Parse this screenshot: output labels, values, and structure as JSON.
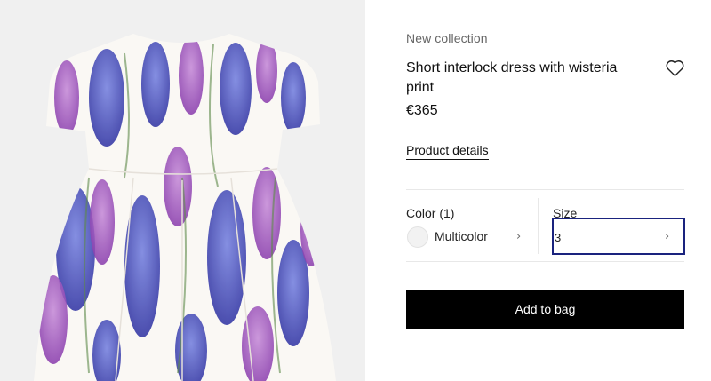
{
  "product": {
    "collection_label": "New collection",
    "title": "Short interlock dress with wisteria print",
    "price": "€365",
    "details_link": "Product details"
  },
  "color": {
    "label": "Color (1)",
    "value": "Multicolor",
    "swatch_color": "#f2f2f2"
  },
  "size": {
    "label": "Size",
    "value": "3"
  },
  "cart": {
    "add_label": "Add to bag"
  },
  "colors": {
    "accent_focus": "#1a237e",
    "button_bg": "#000000",
    "image_bg": "#f0f0f0"
  },
  "icons": {
    "wishlist": "heart-icon",
    "chevron": "chevron-right-icon"
  }
}
